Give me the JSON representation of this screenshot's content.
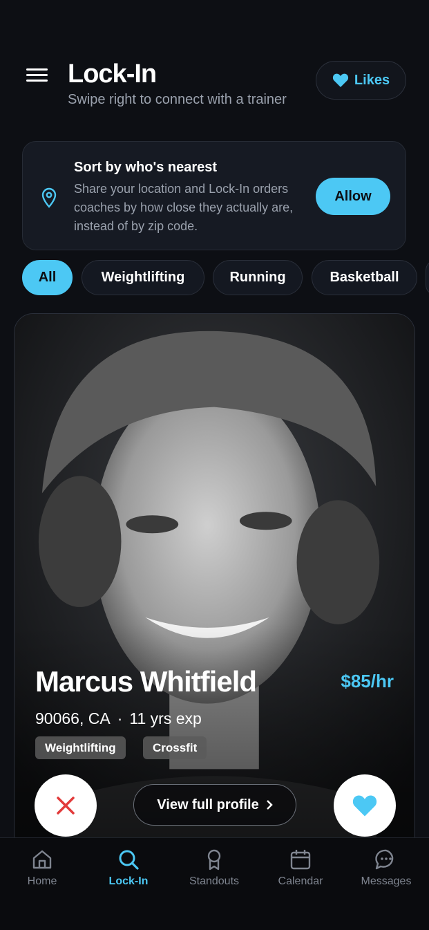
{
  "header": {
    "title": "Lock-In",
    "subtitle": "Swipe right to connect with a trainer",
    "likes_label": "Likes"
  },
  "banner": {
    "title": "Sort by who's nearest",
    "text": "Share your location and Lock-In orders coaches by how close they actually are, instead of by zip code.",
    "allow_label": "Allow"
  },
  "filters": [
    {
      "label": "All",
      "active": true
    },
    {
      "label": "Weightlifting",
      "active": false
    },
    {
      "label": "Running",
      "active": false
    },
    {
      "label": "Basketball",
      "active": false
    }
  ],
  "card": {
    "name": "Marcus Whitfield",
    "rate": "$85/hr",
    "location": "90066, CA",
    "separator": "·",
    "experience": "11 yrs exp",
    "tags": [
      "Weightlifting",
      "Crossfit"
    ],
    "view_profile_label": "View full profile"
  },
  "nav": [
    {
      "label": "Home",
      "icon": "home-icon",
      "active": false
    },
    {
      "label": "Lock-In",
      "icon": "search-icon",
      "active": true
    },
    {
      "label": "Standouts",
      "icon": "award-icon",
      "active": false
    },
    {
      "label": "Calendar",
      "icon": "calendar-icon",
      "active": false
    },
    {
      "label": "Messages",
      "icon": "chat-icon",
      "active": false
    }
  ],
  "colors": {
    "accent": "#4cc8f4",
    "background": "#0d0f14",
    "reject": "#e23b3b"
  }
}
